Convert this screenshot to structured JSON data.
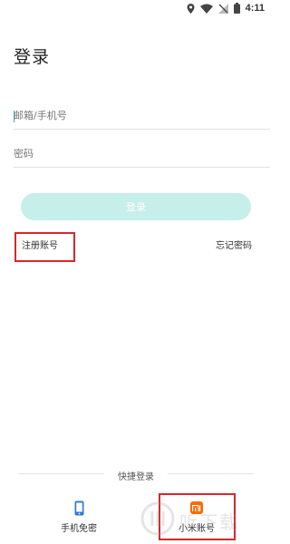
{
  "status_bar": {
    "time": "4:11"
  },
  "page": {
    "title": "登录"
  },
  "form": {
    "email_placeholder": "邮箱/手机号",
    "password_placeholder": "密码",
    "login_button": "登录"
  },
  "links": {
    "register": "注册账号",
    "forgot_password": "忘记密码"
  },
  "quick_login": {
    "label": "快捷登录",
    "items": [
      {
        "icon": "phone-icon",
        "label": "手机免密"
      },
      {
        "icon": "xiaomi-logo-icon",
        "label": "小米账号"
      }
    ]
  },
  "colors": {
    "accent": "#3db1b4",
    "button_bg": "#c6eeea",
    "highlight": "#d9262b",
    "xiaomi_orange": "#ff6900",
    "phone_blue": "#2e7bd6"
  },
  "watermark": {
    "text": "听下载"
  }
}
